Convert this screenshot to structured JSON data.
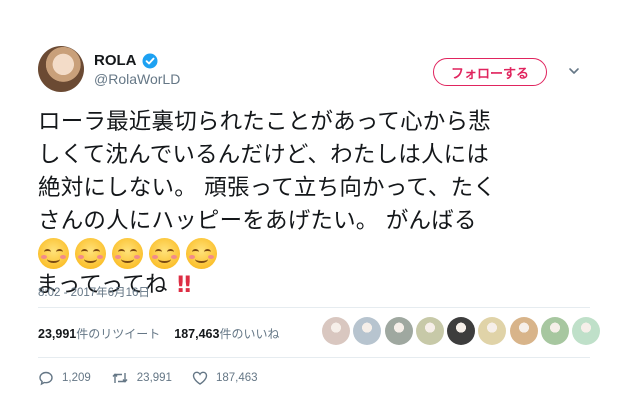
{
  "user": {
    "display_name": "ROLA",
    "handle": "@RolaWorLD",
    "avatar_icon": "profile-photo",
    "verified_icon": "verified-badge-icon"
  },
  "follow_button_label": "フォローする",
  "menu_icon": "chevron-down-icon",
  "tweet": {
    "lines": [
      "ローラ最近裏切られたことがあって心から悲",
      "しくて沈んでいるんだけど、わたしは人には",
      "絶対にしない。 頑張って立ち向かって、たく",
      "さんの人にハッピーをあげたい。 がんばる"
    ],
    "emoji_count": 5,
    "emoji_icon": "smiling-face-with-smiling-eyes-icon",
    "last_line_text": "まってってね",
    "last_line_emoji": "‼"
  },
  "timestamp": "8:02 - 2017年6月16日",
  "stats": {
    "retweets_count": "23,991",
    "retweets_label": "件のリツイート",
    "likes_count": "187,463",
    "likes_label": "件のいいね"
  },
  "likers": [
    {
      "icon": "liker-avatar-1",
      "color": "#d9c7c0"
    },
    {
      "icon": "liker-avatar-2",
      "color": "#b7c4cf"
    },
    {
      "icon": "liker-avatar-3",
      "color": "#9fa8a0"
    },
    {
      "icon": "liker-avatar-4",
      "color": "#c7c9a8"
    },
    {
      "icon": "liker-avatar-5",
      "color": "#3d3d3d"
    },
    {
      "icon": "liker-avatar-6",
      "color": "#e0d3a8"
    },
    {
      "icon": "liker-avatar-7",
      "color": "#d8b48a"
    },
    {
      "icon": "liker-avatar-8",
      "color": "#a7c7a0"
    },
    {
      "icon": "liker-avatar-9",
      "color": "#bfe0c9"
    }
  ],
  "actions": {
    "reply_count": "1,209",
    "retweet_count": "23,991",
    "like_count": "187,463"
  },
  "colors": {
    "follow_accent": "#e0245e",
    "verified": "#1da1f2",
    "secondary_text": "#657786"
  }
}
